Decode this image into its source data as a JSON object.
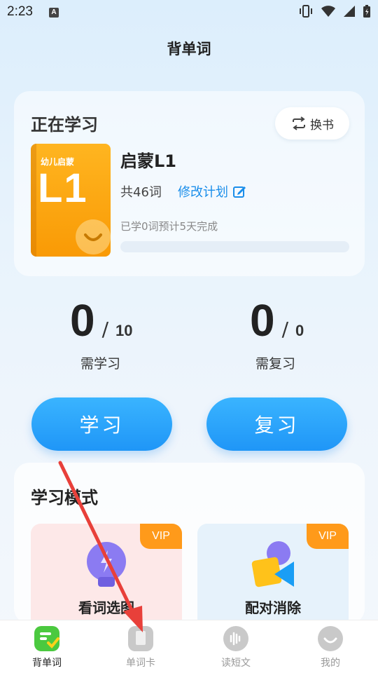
{
  "status_bar": {
    "time": "2:23",
    "notification_icon": "A"
  },
  "page": {
    "title": "背单词"
  },
  "current_study": {
    "heading": "正在学习",
    "switch_button": "换书",
    "book": {
      "cover_badge": "幼儿启蒙",
      "cover_level": "L1",
      "name": "启蒙L1",
      "word_count": "共46词",
      "modify_plan": "修改计划",
      "progress_text": "已学0词预计5天完成",
      "progress_fraction": 0
    }
  },
  "stats": {
    "learn": {
      "value": "0",
      "slash": "/",
      "total": "10",
      "label": "需学习"
    },
    "review": {
      "value": "0",
      "slash": "/",
      "total": "0",
      "label": "需复习"
    }
  },
  "actions": {
    "learn_button": "学习",
    "review_button": "复习"
  },
  "modes": {
    "heading": "学习模式",
    "items": [
      {
        "label": "看词选图",
        "badge": "VIP",
        "icon": "lightbulb-icon"
      },
      {
        "label": "配对消除",
        "badge": "VIP",
        "icon": "shapes-icon"
      }
    ]
  },
  "tabbar": {
    "items": [
      {
        "label": "背单词",
        "icon": "vocab-icon",
        "active": true
      },
      {
        "label": "单词卡",
        "icon": "card-icon",
        "active": false
      },
      {
        "label": "读短文",
        "icon": "reading-icon",
        "active": false
      },
      {
        "label": "我的",
        "icon": "profile-icon",
        "active": false
      }
    ]
  },
  "colors": {
    "accent": "#1f96f7",
    "book": "#fbab12",
    "vip": "#ff9a1a",
    "annotation_arrow": "#e8403a"
  }
}
